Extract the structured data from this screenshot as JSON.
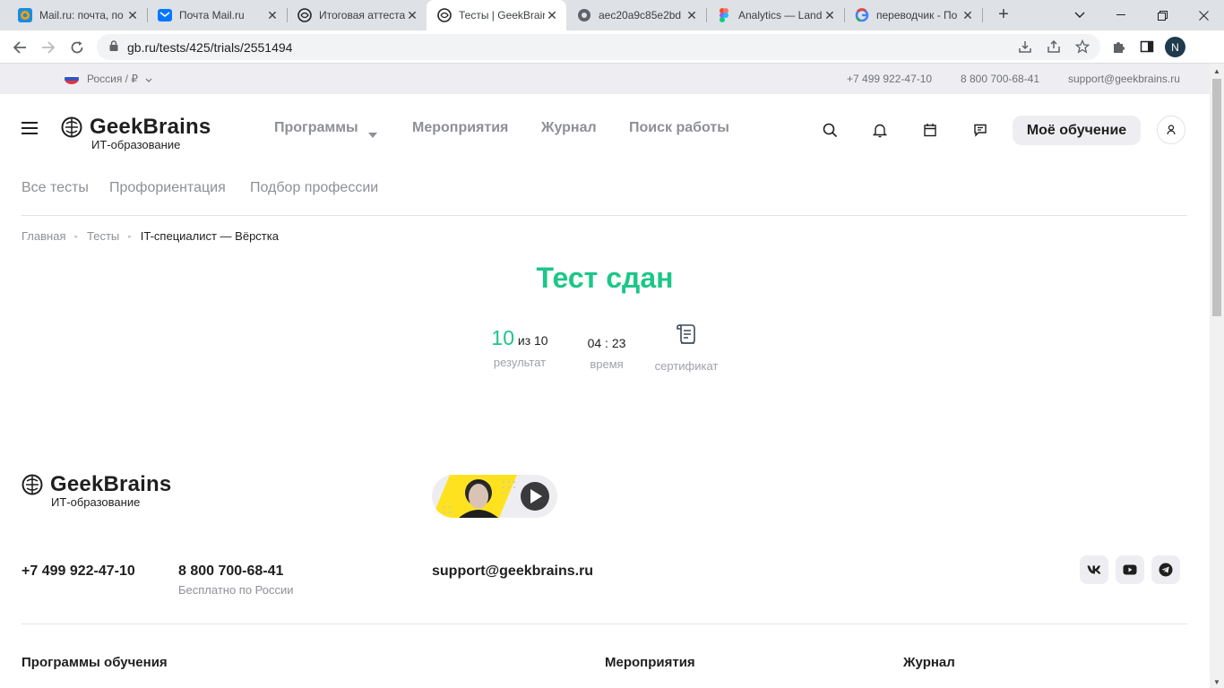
{
  "browser": {
    "tabs": [
      {
        "title": "Mail.ru: почта, по",
        "icon": "mailru-icon",
        "active": false
      },
      {
        "title": "Почта Mail.ru",
        "icon": "mail-envelope-icon",
        "active": false
      },
      {
        "title": "Итоговая аттеста",
        "icon": "geekbrains-icon",
        "active": false
      },
      {
        "title": "Тесты | GeekBrain",
        "icon": "geekbrains-icon",
        "active": true
      },
      {
        "title": "aec20a9c85e2bd",
        "icon": "globe-icon",
        "active": false
      },
      {
        "title": "Analytics — Land",
        "icon": "figma-icon",
        "active": false
      },
      {
        "title": "переводчик - По",
        "icon": "google-icon",
        "active": false
      }
    ],
    "new_tab_label": "+",
    "url": "gb.ru/tests/425/trials/2551494",
    "profile_initial": "N"
  },
  "topbar": {
    "region": "Россия / ₽",
    "phone_1": "+7 499 922-47-10",
    "phone_2": "8 800 700-68-41",
    "email": "support@geekbrains.ru"
  },
  "header": {
    "brand": "GeekBrains",
    "tagline": "ИТ-образование",
    "nav": [
      "Программы",
      "Мероприятия",
      "Журнал",
      "Поиск работы"
    ],
    "my_learning": "Моё обучение"
  },
  "subnav": [
    "Все тесты",
    "Профориентация",
    "Подбор профессии"
  ],
  "breadcrumbs": [
    "Главная",
    "Тесты",
    "IT-специалист — Вёрстка"
  ],
  "result": {
    "title": "Тест сдан",
    "score": "10",
    "score_of": "из 10",
    "score_label": "результат",
    "time": "04 : 23",
    "time_label": "время",
    "certificate_label": "сертификат"
  },
  "footer": {
    "brand": "GeekBrains",
    "tagline": "ИТ-образование",
    "phone_1": "+7 499 922-47-10",
    "phone_2": "8 800 700-68-41",
    "phone_2_note": "Бесплатно по России",
    "email": "support@geekbrains.ru",
    "social": [
      "vk-icon",
      "youtube-icon",
      "telegram-icon"
    ],
    "columns": [
      "Программы обучения",
      "Мероприятия",
      "Журнал"
    ]
  },
  "colors": {
    "accent_green": "#1dc68a",
    "muted_text": "#8e9096",
    "light_bg": "#eeeef2"
  }
}
